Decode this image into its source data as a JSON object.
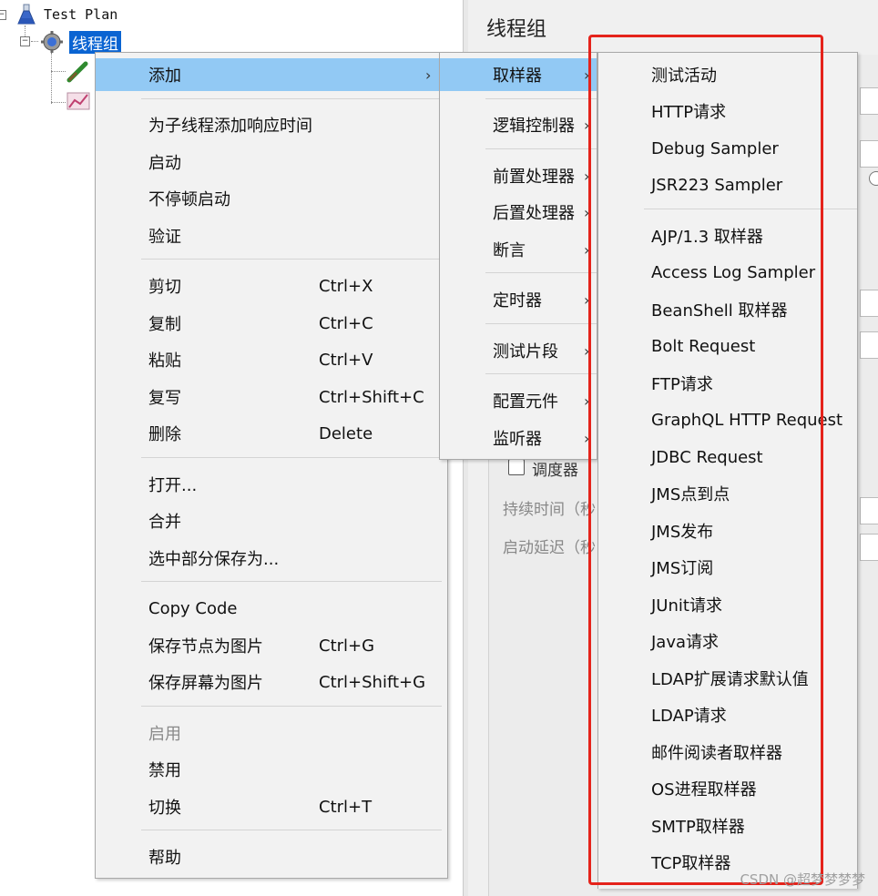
{
  "tree": {
    "root_label": "Test Plan",
    "thread_group_label": "线程组"
  },
  "right_panel": {
    "title": "线程组",
    "scheduler_label": "调度器",
    "duration_label": "持续时间（秒",
    "startup_delay_label": "启动延迟（秒"
  },
  "context_menu": {
    "items": [
      {
        "label": "添加",
        "submenu": true
      },
      {
        "label": "为子线程添加响应时间"
      },
      {
        "label": "启动"
      },
      {
        "label": "不停顿启动"
      },
      {
        "label": "验证"
      },
      {
        "label": "剪切",
        "shortcut": "Ctrl+X"
      },
      {
        "label": "复制",
        "shortcut": "Ctrl+C"
      },
      {
        "label": "粘贴",
        "shortcut": "Ctrl+V"
      },
      {
        "label": "复写",
        "shortcut": "Ctrl+Shift+C"
      },
      {
        "label": "删除",
        "shortcut": "Delete"
      },
      {
        "label": "打开..."
      },
      {
        "label": "合并"
      },
      {
        "label": "选中部分保存为..."
      },
      {
        "label": "Copy Code"
      },
      {
        "label": "保存节点为图片",
        "shortcut": "Ctrl+G"
      },
      {
        "label": "保存屏幕为图片",
        "shortcut": "Ctrl+Shift+G"
      },
      {
        "label": "启用",
        "disabled": true
      },
      {
        "label": "禁用"
      },
      {
        "label": "切换",
        "shortcut": "Ctrl+T"
      },
      {
        "label": "帮助"
      }
    ]
  },
  "add_submenu": {
    "items": [
      {
        "label": "取样器"
      },
      {
        "label": "逻辑控制器"
      },
      {
        "label": "前置处理器"
      },
      {
        "label": "后置处理器"
      },
      {
        "label": "断言"
      },
      {
        "label": "定时器"
      },
      {
        "label": "测试片段"
      },
      {
        "label": "配置元件"
      },
      {
        "label": "监听器"
      }
    ]
  },
  "sampler_submenu": {
    "items": [
      "测试活动",
      "HTTP请求",
      "Debug Sampler",
      "JSR223 Sampler",
      "AJP/1.3 取样器",
      "Access Log Sampler",
      "BeanShell 取样器",
      "Bolt Request",
      "FTP请求",
      "GraphQL HTTP Request",
      "JDBC Request",
      "JMS点到点",
      "JMS发布",
      "JMS订阅",
      "JUnit请求",
      "Java请求",
      "LDAP扩展请求默认值",
      "LDAP请求",
      "邮件阅读者取样器",
      "OS进程取样器",
      "SMTP取样器",
      "TCP取样器"
    ]
  },
  "watermark": "CSDN @超梦梦梦梦",
  "colors": {
    "highlight": "#92c9f4",
    "tree_selection": "#0a64d2",
    "annotation_box": "#e5231b"
  }
}
